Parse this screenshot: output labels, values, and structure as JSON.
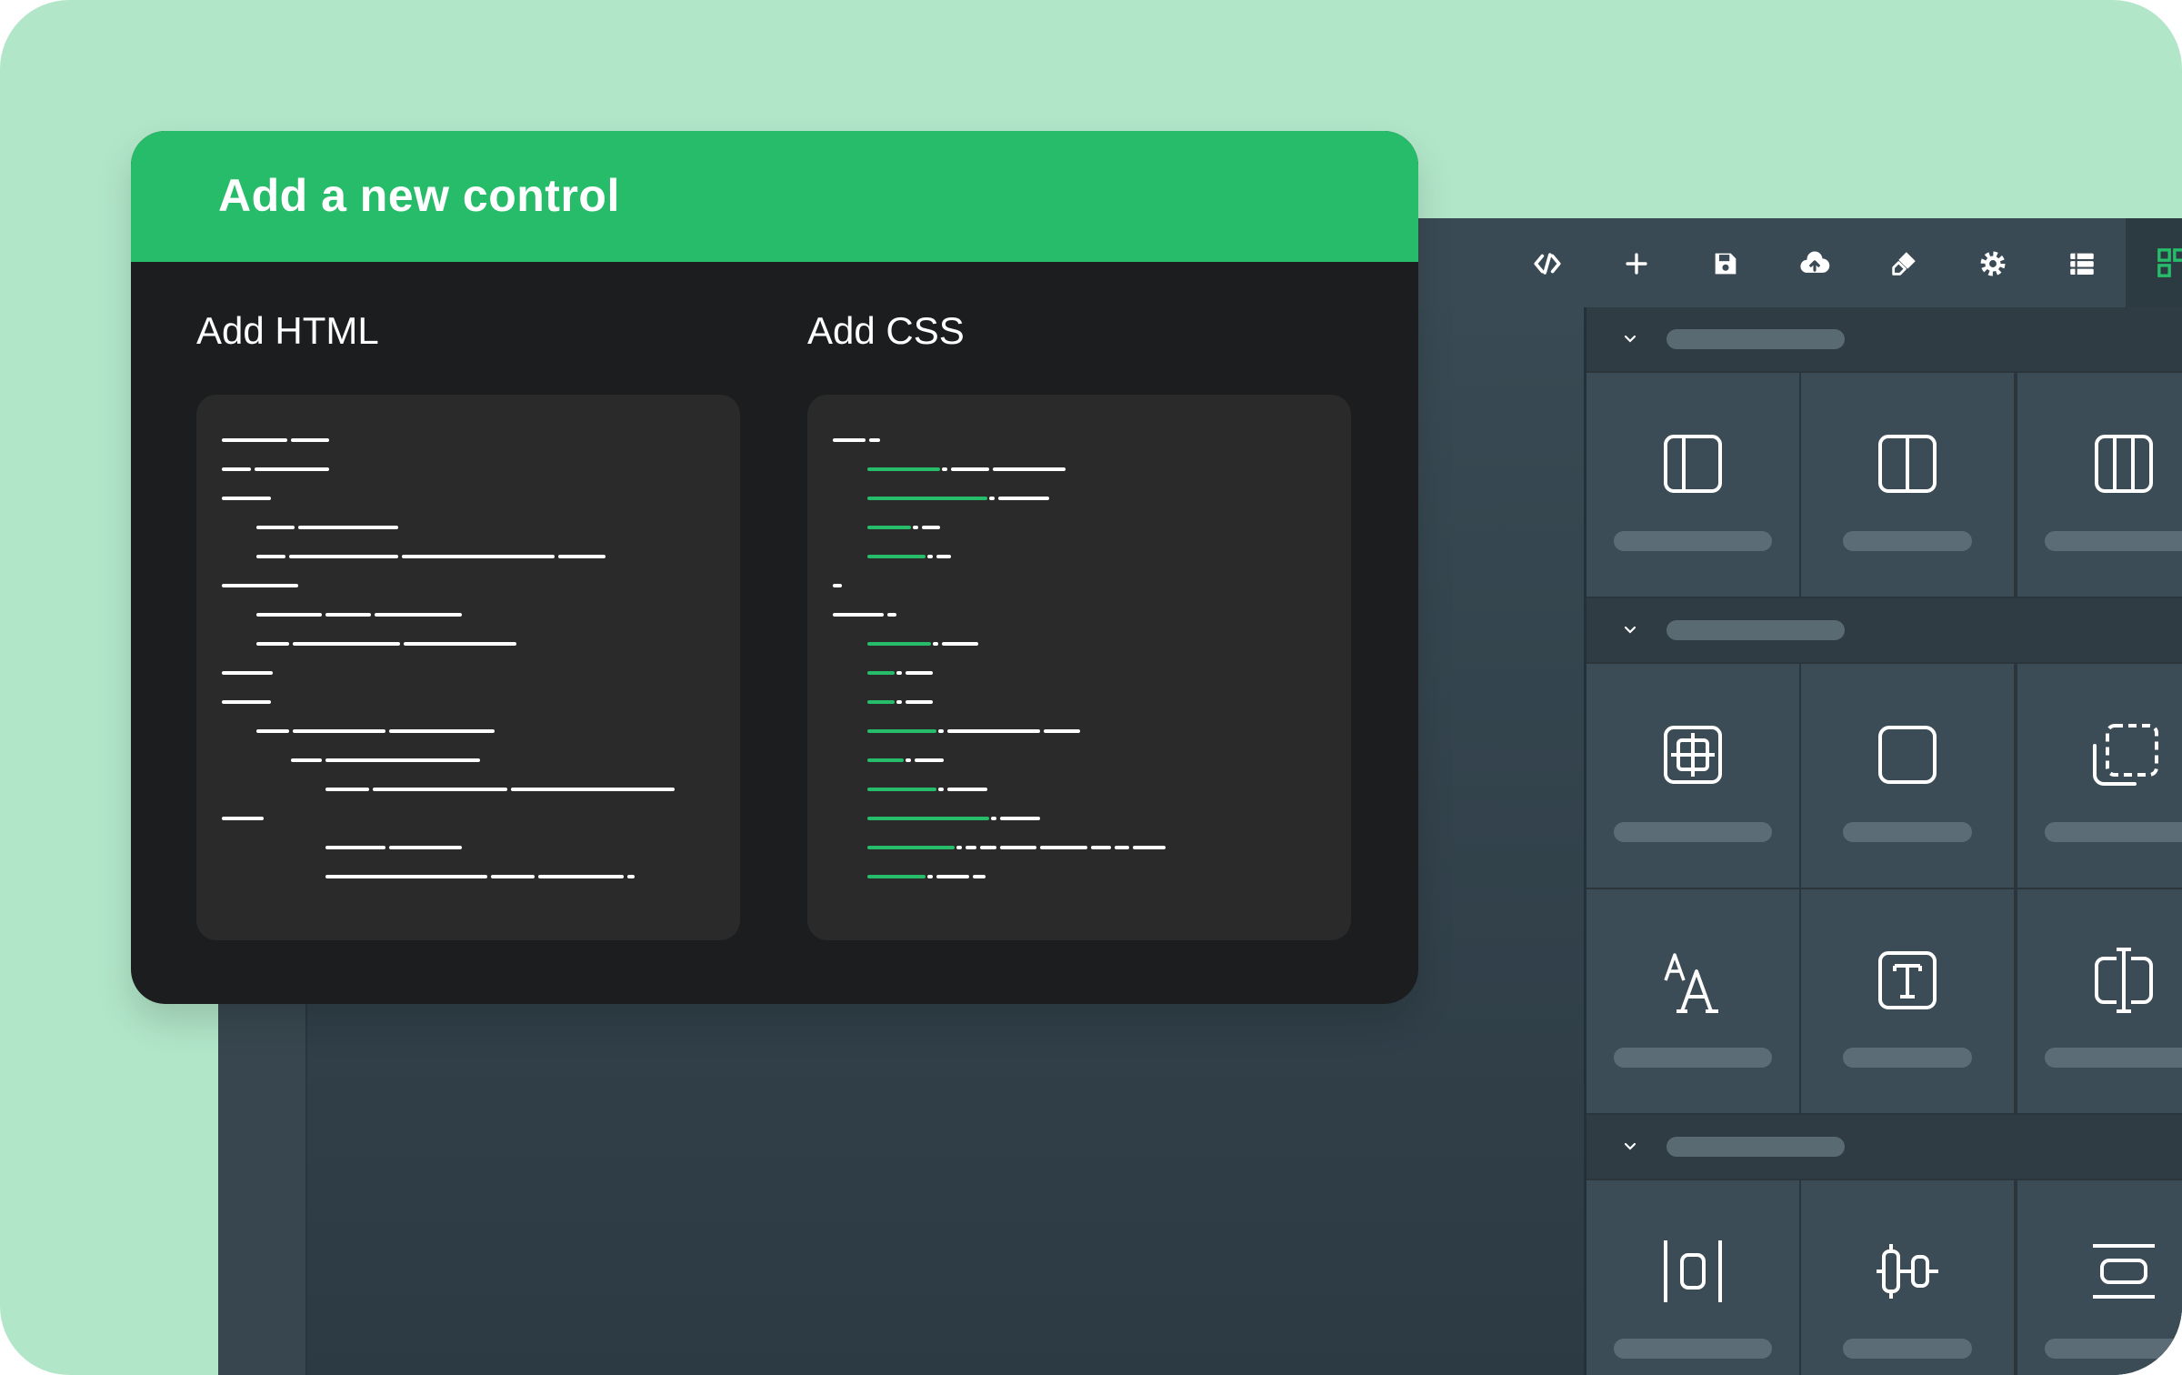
{
  "dialog": {
    "title": "Add a new control",
    "html_label": "Add HTML",
    "css_label": "Add CSS"
  },
  "toolbar": {
    "buttons": [
      {
        "name": "code-icon"
      },
      {
        "name": "plus-icon"
      },
      {
        "name": "save-icon"
      },
      {
        "name": "cloud-upload-icon"
      },
      {
        "name": "brush-icon"
      },
      {
        "name": "gear-icon"
      },
      {
        "name": "layers-icon"
      },
      {
        "name": "blocks-icon"
      }
    ]
  },
  "panel": {
    "sections": [
      {
        "tiles": [
          "one-column-icon",
          "two-column-icon",
          "three-column-icon"
        ]
      },
      {
        "tiles": [
          "grid-frame-icon",
          "rounded-box-icon",
          "dashed-frame-icon",
          "typography-icon",
          "text-box-icon",
          "text-input-icon"
        ]
      },
      {
        "tiles": [
          "spacer-icon",
          "slider-icon",
          "divider-icon"
        ]
      }
    ]
  },
  "colors": {
    "background": "#b2e6c9",
    "accent": "#27bc69",
    "dialog": "#1c1d1f",
    "editor": "#3a4b55"
  }
}
